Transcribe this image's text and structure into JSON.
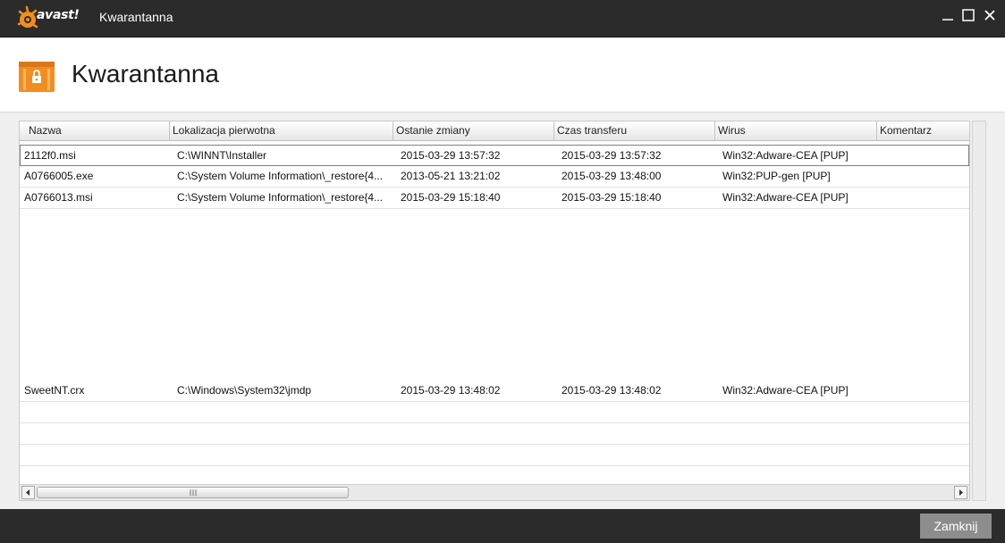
{
  "window": {
    "logo_text": "avast!",
    "title": "Kwarantanna",
    "controls": {
      "minimize": "—",
      "maximize": "☐",
      "close": "✕"
    }
  },
  "header": {
    "title": "Kwarantanna"
  },
  "table": {
    "columns": [
      "Nazwa",
      "Lokalizacja pierwotna",
      "Ostanie zmiany",
      "Czas transferu",
      "Wirus",
      "Komentarz"
    ],
    "rows": [
      {
        "name": "2112f0.msi",
        "location": "C:\\WINNT\\Installer",
        "modified": "2015-03-29 13:57:32",
        "transferred": "2015-03-29 13:57:32",
        "virus": "Win32:Adware-CEA [PUP]",
        "comment": ""
      },
      {
        "name": "A0766005.exe",
        "location": "C:\\System Volume Information\\_restore{4...",
        "modified": "2013-05-21 13:21:02",
        "transferred": "2015-03-29 13:48:00",
        "virus": "Win32:PUP-gen [PUP]",
        "comment": ""
      },
      {
        "name": "A0766013.msi",
        "location": "C:\\System Volume Information\\_restore{4...",
        "modified": "2015-03-29 15:18:40",
        "transferred": "2015-03-29 15:18:40",
        "virus": "Win32:Adware-CEA [PUP]",
        "comment": ""
      },
      {
        "name": "SweetNT.crx",
        "location": "C:\\Windows\\System32\\jmdp",
        "modified": "2015-03-29 13:48:02",
        "transferred": "2015-03-29 13:48:02",
        "virus": "Win32:Adware-CEA [PUP]",
        "comment": ""
      }
    ]
  },
  "footer": {
    "close_label": "Zamknij"
  },
  "colors": {
    "titlebar": "#2b2b2b",
    "accent_orange": "#f28e1e",
    "button_gray": "#8d8d8d"
  },
  "icons": {
    "logo": "avast-ball-icon",
    "header": "quarantine-chest-icon"
  }
}
